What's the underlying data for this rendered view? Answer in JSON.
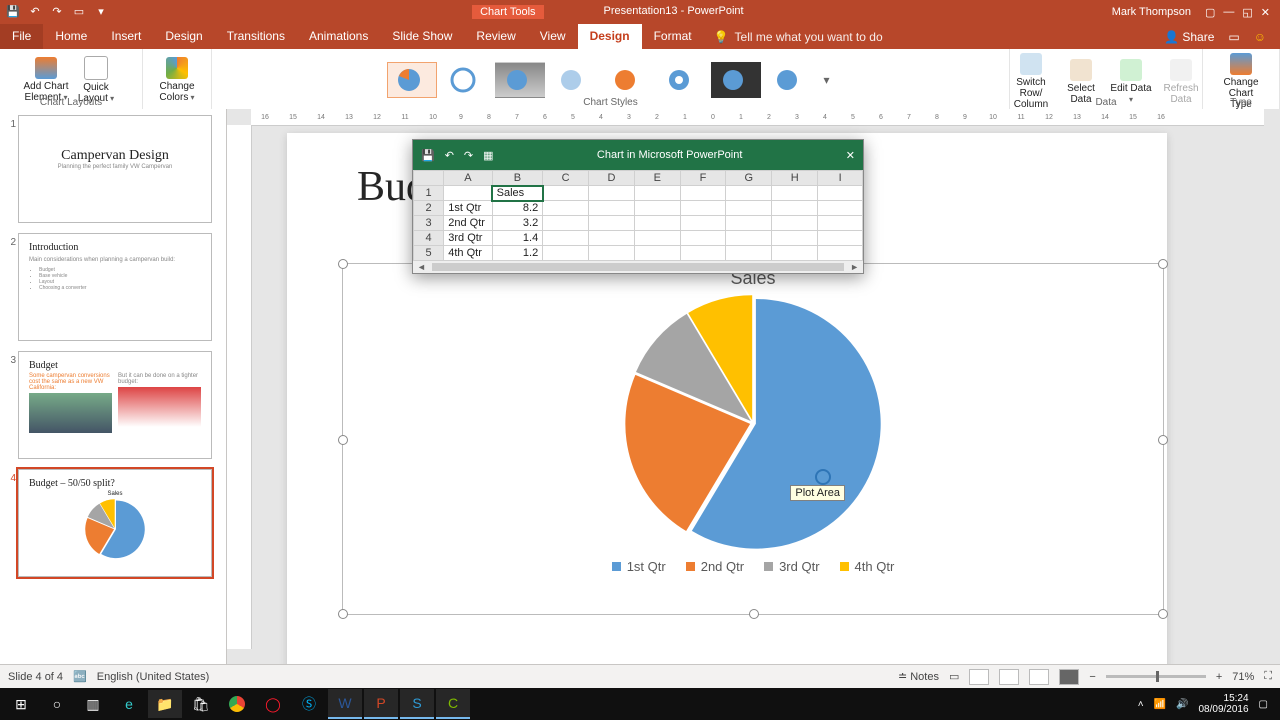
{
  "app": {
    "chart_tools": "Chart Tools",
    "doc_title": "Presentation13 - PowerPoint",
    "user": "Mark Thompson"
  },
  "tabs": {
    "file": "File",
    "home": "Home",
    "insert": "Insert",
    "design": "Design",
    "transitions": "Transitions",
    "animations": "Animations",
    "slideshow": "Slide Show",
    "review": "Review",
    "view": "View",
    "ct_design": "Design",
    "ct_format": "Format",
    "tellme": "Tell me what you want to do",
    "share": "Share"
  },
  "ribbon": {
    "add_chart_element": "Add Chart Element",
    "quick_layout": "Quick Layout",
    "change_colors": "Change Colors",
    "chart_layouts": "Chart Layouts",
    "chart_styles": "Chart Styles",
    "switch": "Switch Row/ Column",
    "select_data": "Select Data",
    "edit_data": "Edit Data",
    "refresh": "Refresh Data",
    "data_group": "Data",
    "change_type": "Change Chart Type",
    "type_group": "Type"
  },
  "thumbs": {
    "s1_title": "Campervan Design",
    "s1_sub": "Planning the perfect family VW Campervan",
    "s2_title": "Introduction",
    "s2_line": "Main considerations when planning a campervan build:",
    "s2_b1": "Budget",
    "s2_b2": "Base vehicle",
    "s2_b3": "Layout",
    "s2_b4": "Choosing a converter",
    "s3_title": "Budget",
    "s3_l": "Some campervan conversions cost the same as a new VW California:",
    "s3_r": "But it can be done on a tighter budget:",
    "s4_title": "Budget – 50/50 split?"
  },
  "slide": {
    "title": "Budget – 50/50 split?"
  },
  "excel": {
    "window_title": "Chart in Microsoft PowerPoint",
    "cols": [
      "A",
      "B",
      "C",
      "D",
      "E",
      "F",
      "G",
      "H",
      "I"
    ],
    "header": "Sales",
    "rows": [
      {
        "n": "2",
        "label": "1st Qtr",
        "val": "8.2"
      },
      {
        "n": "3",
        "label": "2nd Qtr",
        "val": "3.2"
      },
      {
        "n": "4",
        "label": "3rd Qtr",
        "val": "1.4"
      },
      {
        "n": "5",
        "label": "4th Qtr",
        "val": "1.2"
      }
    ]
  },
  "chart_data": {
    "type": "pie",
    "title": "Sales",
    "categories": [
      "1st Qtr",
      "2nd Qtr",
      "3rd Qtr",
      "4th Qtr"
    ],
    "values": [
      8.2,
      3.2,
      1.4,
      1.2
    ],
    "colors": [
      "#5B9BD5",
      "#ED7D31",
      "#A5A5A5",
      "#FFC000"
    ]
  },
  "tooltip": "Plot Area",
  "status": {
    "slide_of": "Slide 4 of 4",
    "lang": "English (United States)",
    "notes": "Notes",
    "zoom": "71%"
  },
  "tray": {
    "time": "15:24",
    "date": "08/09/2016"
  }
}
